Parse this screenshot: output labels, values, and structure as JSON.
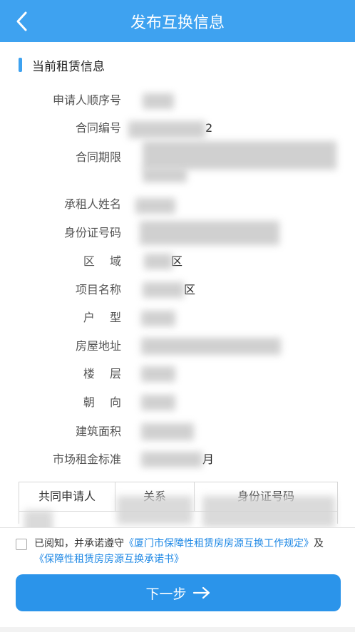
{
  "header": {
    "title": "发布互换信息",
    "back_icon": "chevron-left-icon"
  },
  "section": {
    "title": "当前租赁信息"
  },
  "fields": [
    {
      "label": "申请人顺序号",
      "value": ""
    },
    {
      "label": "合同编号",
      "value": "2"
    },
    {
      "label": "合同期限",
      "value": ""
    },
    {
      "label": "承租人姓名",
      "value": ""
    },
    {
      "label": "身份证号码",
      "value": ""
    },
    {
      "label": "区　 域",
      "value": "区"
    },
    {
      "label": "项目名称",
      "value": "区"
    },
    {
      "label": "户　 型",
      "value": ""
    },
    {
      "label": "房屋地址",
      "value": ""
    },
    {
      "label": "楼　 层",
      "value": ""
    },
    {
      "label": "朝　 向",
      "value": ""
    },
    {
      "label": "建筑面积",
      "value": ""
    },
    {
      "label": "市场租金标准",
      "value": "月"
    }
  ],
  "co_applicants": {
    "headers": [
      "共同申请人",
      "关系",
      "身份证号码"
    ]
  },
  "agreement": {
    "prefix": "已阅知，并承诺遵守",
    "link1": "《厦门市保障性租赁房房源互换工作规定》",
    "middle": "及",
    "link2": "《保障性租赁房房源互换承诺书》"
  },
  "next_button": {
    "label": "下一步"
  },
  "colors": {
    "primary": "#3ea2f0",
    "button": "#2b94ea",
    "link": "#1e88e5"
  }
}
